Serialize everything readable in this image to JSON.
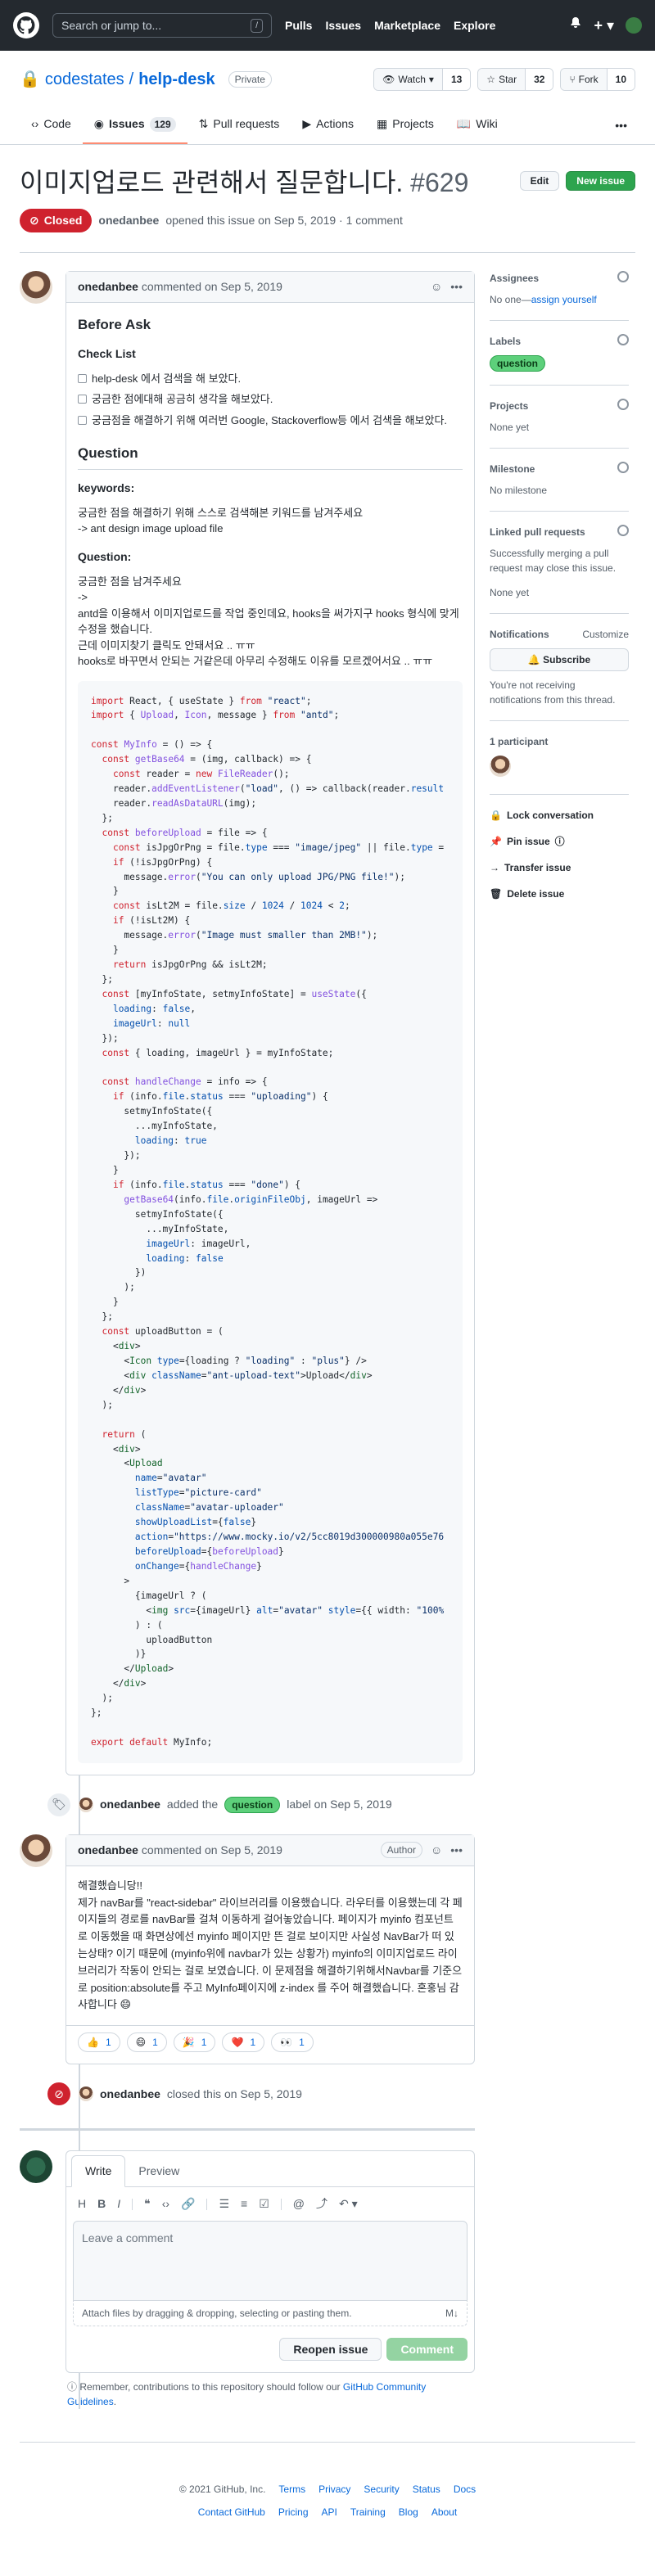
{
  "header": {
    "search_placeholder": "Search or jump to...",
    "slash": "/",
    "nav": [
      "Pulls",
      "Issues",
      "Marketplace",
      "Explore"
    ]
  },
  "repo": {
    "owner": "codestates",
    "name": "help-desk",
    "visibility": "Private",
    "watch": "Watch",
    "watch_count": "13",
    "star": "Star",
    "star_count": "32",
    "fork": "Fork",
    "fork_count": "10"
  },
  "tabs": [
    {
      "label": "Code"
    },
    {
      "label": "Issues",
      "count": "129"
    },
    {
      "label": "Pull requests"
    },
    {
      "label": "Actions"
    },
    {
      "label": "Projects"
    },
    {
      "label": "Wiki"
    }
  ],
  "issue": {
    "title": "이미지업로드 관련해서 질문합니다.",
    "number": "#629",
    "edit": "Edit",
    "new_issue": "New issue",
    "state": "Closed",
    "author": "onedanbee",
    "opened_text": "opened this issue on Sep 5, 2019 · 1 comment"
  },
  "comment1": {
    "author": "onedanbee",
    "time": "commented on Sep 5, 2019",
    "h_before": "Before Ask",
    "h_check": "Check List",
    "checks": [
      "help-desk 에서 검색을 해 보았다.",
      "궁금한 점에대해 공금히 생각을 해보았다.",
      "궁금점을 해결하기 위해 여러번 Google, Stackoverflow등 에서 검색을 해보았다."
    ],
    "h_question": "Question",
    "h_keywords": "keywords:",
    "kw1": "궁금한 점을 해결하기 위해 스스로 검색해본 키워드를 남겨주세요",
    "kw2": "-> ant design image upload file",
    "h_q": "Question:",
    "q1": "궁금한 점을 남겨주세요",
    "q2": "->",
    "q3": "antd을 이용해서 이미지업로드를 작업 중인데요, hooks을 써가지구 hooks 형식에 맞게 수정을 했습니다.",
    "q4": "근데 이미지찾기 클릭도 안돼서요 .. ㅠㅠ",
    "q5": "hooks로 바꾸면서 안되는 거같은데 아무리 수정해도 이유를 모르겠어서요 .. ㅠㅠ"
  },
  "event_label": {
    "author": "onedanbee",
    "pre": "added the",
    "label": "question",
    "post": "label on Sep 5, 2019"
  },
  "comment2": {
    "author": "onedanbee",
    "time": "commented on Sep 5, 2019",
    "badge": "Author",
    "line1": "해결했습니당!!",
    "body": "제가 navBar를 \"react-sidebar\" 라이브러리를 이용했습니다. 라우터를 이용했는데 각 페이지들의 경로를 navBar를 걸쳐 이동하게 걸어놓았습니다. 페이지가 myinfo 컴포넌트로 이동했을 때 화면상에선 myinfo 페이지만 뜬 걸로 보이지만 사실성 NavBar가 떠 있는상태? 이기 때문에 (myinfo위에 navbar가 있는 상황가) myinfo의 이미지업로드 라이브러리가 작동이 안되는 걸로 보였습니다. 이 문제점을 해결하기위해서Navbar를 기준으로 position:absolute를 주고 MyInfo페이지에 z-index 를 주어 해결했습니다. 혼홍님 감사합니다 😄",
    "reactions": [
      {
        "e": "👍",
        "n": "1"
      },
      {
        "e": "😄",
        "n": "1"
      },
      {
        "e": "🎉",
        "n": "1"
      },
      {
        "e": "❤️",
        "n": "1"
      },
      {
        "e": "👀",
        "n": "1"
      }
    ]
  },
  "event_closed": {
    "author": "onedanbee",
    "text": "closed this on Sep 5, 2019"
  },
  "editor": {
    "write": "Write",
    "preview": "Preview",
    "placeholder": "Leave a comment",
    "attach": "Attach files by dragging & dropping, selecting or pasting them.",
    "reopen": "Reopen issue",
    "comment": "Comment",
    "remind_pre": "Remember, contributions to this repository should follow our",
    "remind_link": "GitHub Community Guidelines",
    "remind_post": "."
  },
  "sidebar": {
    "assignees": "Assignees",
    "assignees_val": "No one—",
    "assign_self": "assign yourself",
    "labels": "Labels",
    "label": "question",
    "projects": "Projects",
    "projects_val": "None yet",
    "milestone": "Milestone",
    "milestone_val": "No milestone",
    "linked": "Linked pull requests",
    "linked_desc": "Successfully merging a pull request may close this issue.",
    "linked_val": "None yet",
    "notif": "Notifications",
    "customize": "Customize",
    "subscribe": "Subscribe",
    "notif_desc": "You're not receiving notifications from this thread.",
    "participants": "1 participant",
    "lock": "Lock conversation",
    "pin": "Pin issue",
    "transfer": "Transfer issue",
    "delete": "Delete issue"
  },
  "footer": {
    "copy": "© 2021 GitHub, Inc.",
    "row1": [
      "Terms",
      "Privacy",
      "Security",
      "Status",
      "Docs"
    ],
    "row2": [
      "Contact GitHub",
      "Pricing",
      "API",
      "Training",
      "Blog",
      "About"
    ]
  }
}
